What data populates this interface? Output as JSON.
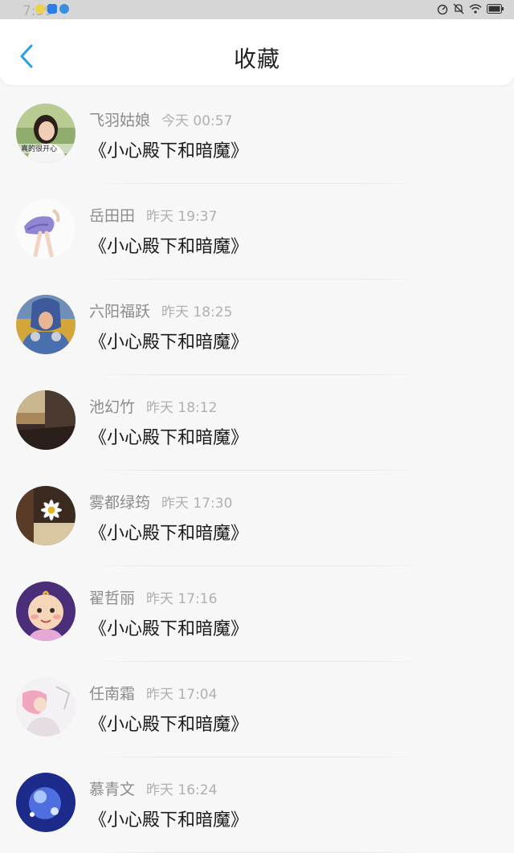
{
  "status_bar": {
    "time": "7:59",
    "left_icons": [
      "notification-icon",
      "app-icon",
      "app-icon-2"
    ],
    "right_icons": [
      "speed-icon",
      "mute-icon",
      "wifi-icon",
      "battery-icon"
    ]
  },
  "header": {
    "back_icon": "chevron-left-icon",
    "title": "收藏"
  },
  "colors": {
    "accent": "#2b9ce8",
    "name": "#8c8c8c",
    "time": "#b0b0b0",
    "book": "#1a1a1a"
  },
  "favorites": [
    {
      "name": "飞羽姑娘",
      "time": "今天 00:57",
      "book": "《小心殿下和暗魔》",
      "avatar_caption": "真的很开心"
    },
    {
      "name": "岳田田",
      "time": "昨天 19:37",
      "book": "《小心殿下和暗魔》"
    },
    {
      "name": "六阳福跃",
      "time": "昨天 18:25",
      "book": "《小心殿下和暗魔》"
    },
    {
      "name": "池幻竹",
      "time": "昨天 18:12",
      "book": "《小心殿下和暗魔》"
    },
    {
      "name": "雾都绿筠",
      "time": "昨天 17:30",
      "book": "《小心殿下和暗魔》"
    },
    {
      "name": "翟哲丽",
      "time": "昨天 17:16",
      "book": "《小心殿下和暗魔》"
    },
    {
      "name": "任南霜",
      "time": "昨天 17:04",
      "book": "《小心殿下和暗魔》"
    },
    {
      "name": "慕青文",
      "time": "昨天 16:24",
      "book": "《小心殿下和暗魔》"
    }
  ]
}
